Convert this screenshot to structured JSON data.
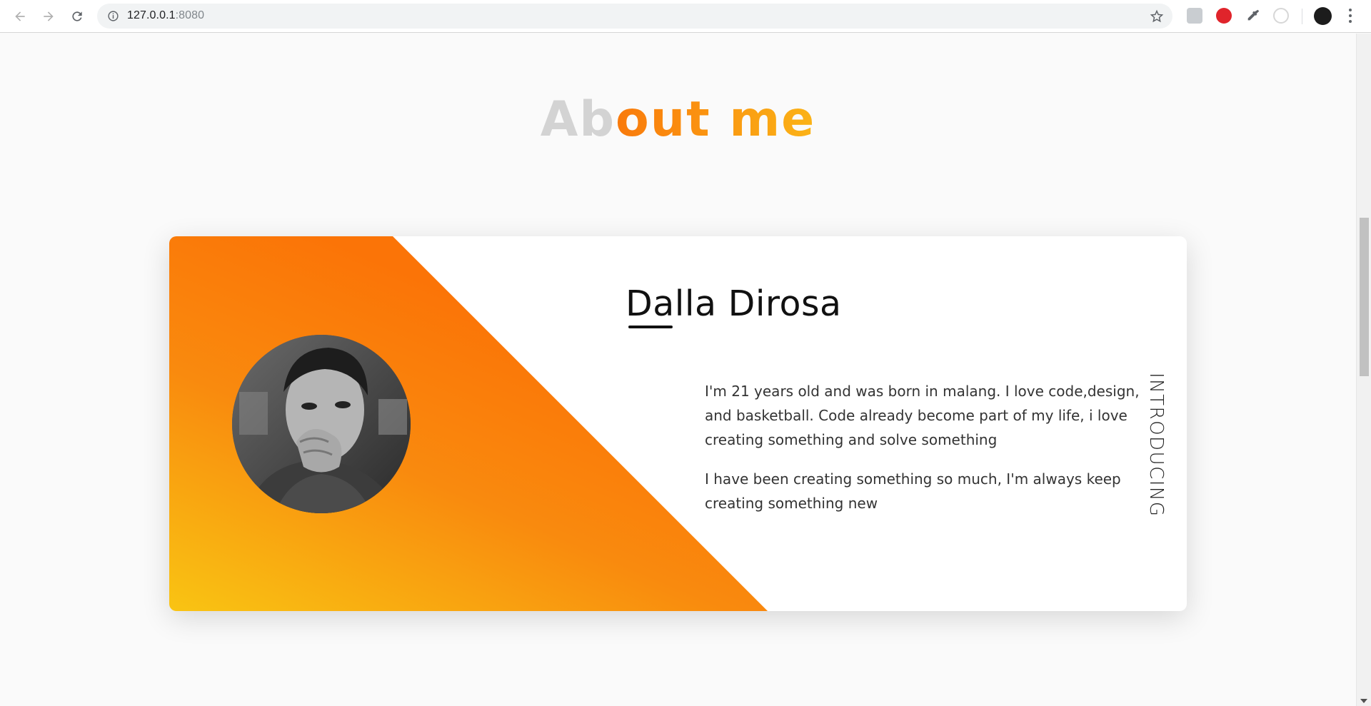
{
  "browser": {
    "url_host": "127.0.0.1",
    "url_port": ":8080",
    "icons": [
      "back-icon",
      "forward-icon",
      "reload-icon",
      "info-icon",
      "star-icon",
      "eyedropper-icon",
      "menu-icon"
    ]
  },
  "section": {
    "title_part1": "Ab",
    "title_part2": "out me"
  },
  "card": {
    "name": "Dalla Dirosa",
    "paragraphs": [
      "I'm 21 years old and was born in malang. I love code,design, and basketball. Code already become part of my life, i love creating something and solve something",
      "I have been creating something so much, I'm always keep creating something new"
    ],
    "side_label": "INTRODUCING"
  },
  "colors": {
    "accent_orange": "#f97a0c",
    "accent_yellow": "#f9c413",
    "title_grey": "#d3d3d3"
  }
}
